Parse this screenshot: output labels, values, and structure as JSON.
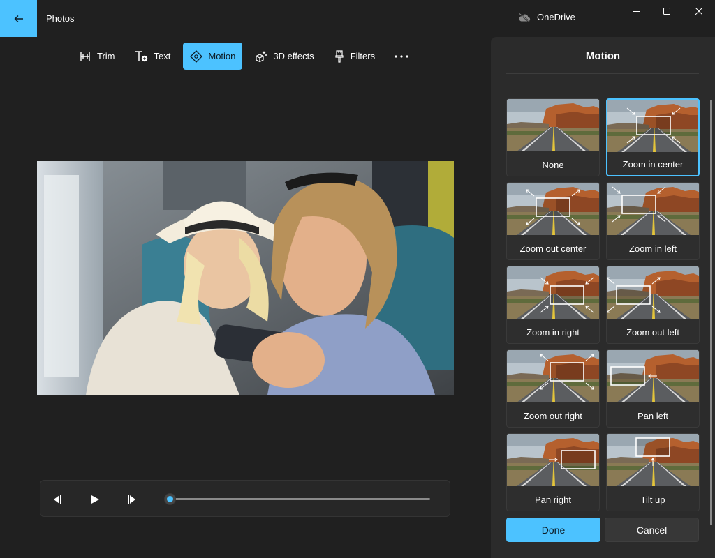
{
  "titlebar": {
    "app_title": "Photos",
    "cloud_label": "OneDrive"
  },
  "toolbar": {
    "items": [
      {
        "label": "Trim",
        "icon": "trim-icon",
        "active": false
      },
      {
        "label": "Text",
        "icon": "text-icon",
        "active": false
      },
      {
        "label": "Motion",
        "icon": "motion-icon",
        "active": true
      },
      {
        "label": "3D effects",
        "icon": "3d-effects-icon",
        "active": false
      },
      {
        "label": "Filters",
        "icon": "filters-icon",
        "active": false
      }
    ],
    "more_icon": "more-icon"
  },
  "playback": {
    "progress": 0.0
  },
  "panel": {
    "title": "Motion",
    "motions": [
      {
        "label": "None",
        "selected": false
      },
      {
        "label": "Zoom in center",
        "selected": true
      },
      {
        "label": "Zoom out center",
        "selected": false
      },
      {
        "label": "Zoom in left",
        "selected": false
      },
      {
        "label": "Zoom in right",
        "selected": false
      },
      {
        "label": "Zoom out left",
        "selected": false
      },
      {
        "label": "Zoom out right",
        "selected": false
      },
      {
        "label": "Pan left",
        "selected": false
      },
      {
        "label": "Pan right",
        "selected": false
      },
      {
        "label": "Tilt up",
        "selected": false
      }
    ],
    "done_label": "Done",
    "cancel_label": "Cancel"
  },
  "colors": {
    "accent": "#4cc2ff",
    "background": "#202020",
    "panel": "#2b2b2b"
  }
}
